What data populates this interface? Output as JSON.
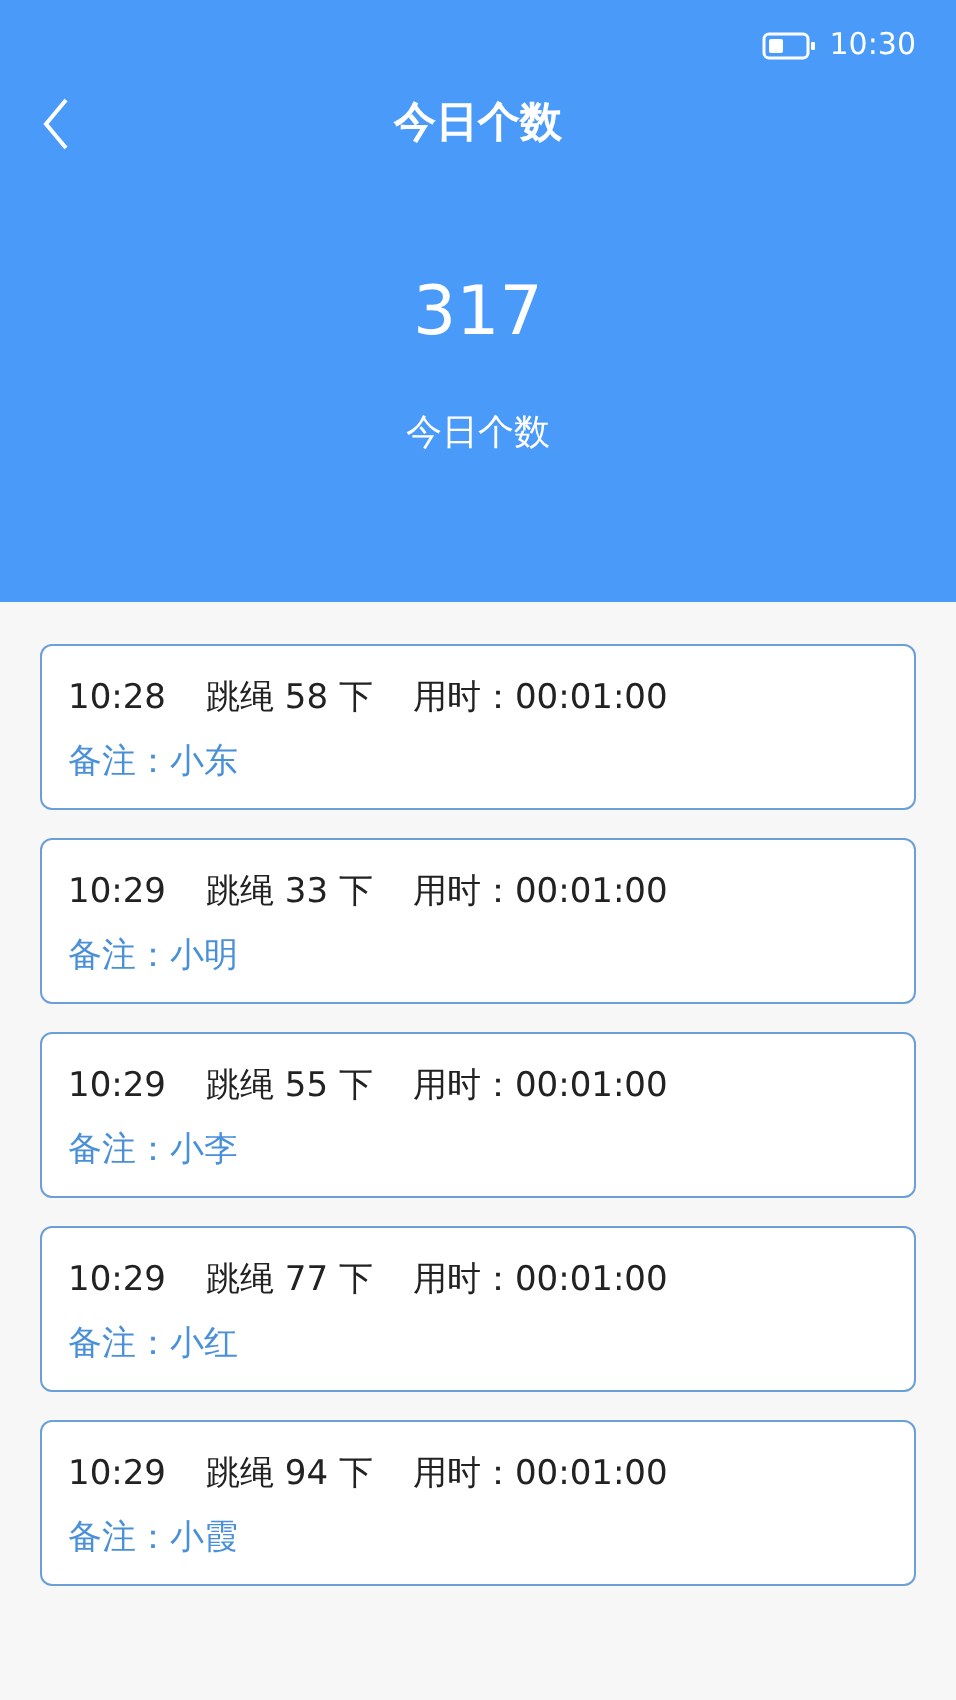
{
  "status_bar": {
    "time": "10:30"
  },
  "header": {
    "title": "今日个数",
    "total": "317",
    "total_label": "今日个数"
  },
  "records": [
    {
      "time": "10:28",
      "count": "跳绳 58 下",
      "duration": "用时：00:01:00",
      "note": "备注：小东"
    },
    {
      "time": "10:29",
      "count": "跳绳 33 下",
      "duration": "用时：00:01:00",
      "note": "备注：小明"
    },
    {
      "time": "10:29",
      "count": "跳绳 55 下",
      "duration": "用时：00:01:00",
      "note": "备注：小李"
    },
    {
      "time": "10:29",
      "count": "跳绳 77 下",
      "duration": "用时：00:01:00",
      "note": "备注：小红"
    },
    {
      "time": "10:29",
      "count": "跳绳 94 下",
      "duration": "用时：00:01:00",
      "note": "备注：小霞"
    }
  ]
}
